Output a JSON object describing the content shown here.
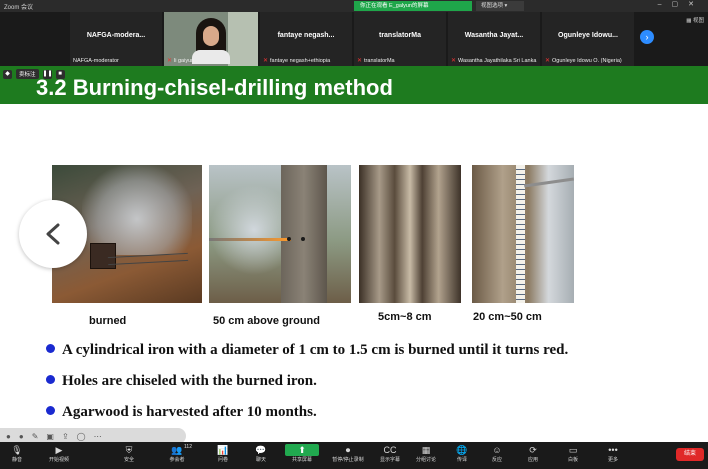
{
  "window": {
    "app_title": "Zoom 会议",
    "share_banner": "你正在观看 E_galyun的屏幕",
    "view_options": "视图选项"
  },
  "participants": {
    "gallery_label": "视图",
    "tiles": [
      {
        "big": "NAFGA-modera...",
        "small": "NAFGA-moderator",
        "muted": false
      },
      {
        "big": "",
        "small": "li gaiyun",
        "muted": true
      },
      {
        "big": "fantaye negash...",
        "small": "fantaye negash+ethiopia",
        "muted": true
      },
      {
        "big": "translatorMa",
        "small": "translatorMa",
        "muted": true
      },
      {
        "big": "Wasantha Jayat...",
        "small": "Wasantha Jayathilaka Sri Lanka",
        "muted": true
      },
      {
        "big": "Ogunleye Idowu...",
        "small": "Ogunleye Idowu O. (Nigeria)",
        "muted": true
      }
    ]
  },
  "share_tools": {
    "label": "卖标注"
  },
  "slide": {
    "title": "3.2  Burning-chisel-drilling method",
    "captions": [
      "burned",
      "50 cm above ground",
      "5cm~8 cm",
      "20 cm~50 cm"
    ],
    "bullets": [
      "A cylindrical iron with a diameter of 1 cm to 1.5 cm is burned until it turns red.",
      "Holes are chiseled with the burned iron.",
      "Agarwood is harvested after 10 months."
    ]
  },
  "toolbar": {
    "items": [
      {
        "glyph": "🎙",
        "label": "静音"
      },
      {
        "glyph": "▶",
        "label": "开始视频"
      },
      {
        "glyph": "⛨",
        "label": "安全"
      },
      {
        "glyph": "👥",
        "label": "参会者",
        "badge": "112"
      },
      {
        "glyph": "📊",
        "label": "问卷"
      },
      {
        "glyph": "💬",
        "label": "聊天"
      },
      {
        "glyph": "⬆",
        "label": "共享屏幕"
      },
      {
        "glyph": "⏺",
        "label": "暂停/停止录制"
      },
      {
        "glyph": "CC",
        "label": "显示字幕"
      },
      {
        "glyph": "▦",
        "label": "分组讨论"
      },
      {
        "glyph": "🌐",
        "label": "传译"
      },
      {
        "glyph": "☺",
        "label": "反应"
      },
      {
        "glyph": "⟳",
        "label": "应用"
      },
      {
        "glyph": "▭",
        "label": "白板"
      },
      {
        "glyph": "•••",
        "label": "更多"
      }
    ],
    "end_label": "结束"
  }
}
